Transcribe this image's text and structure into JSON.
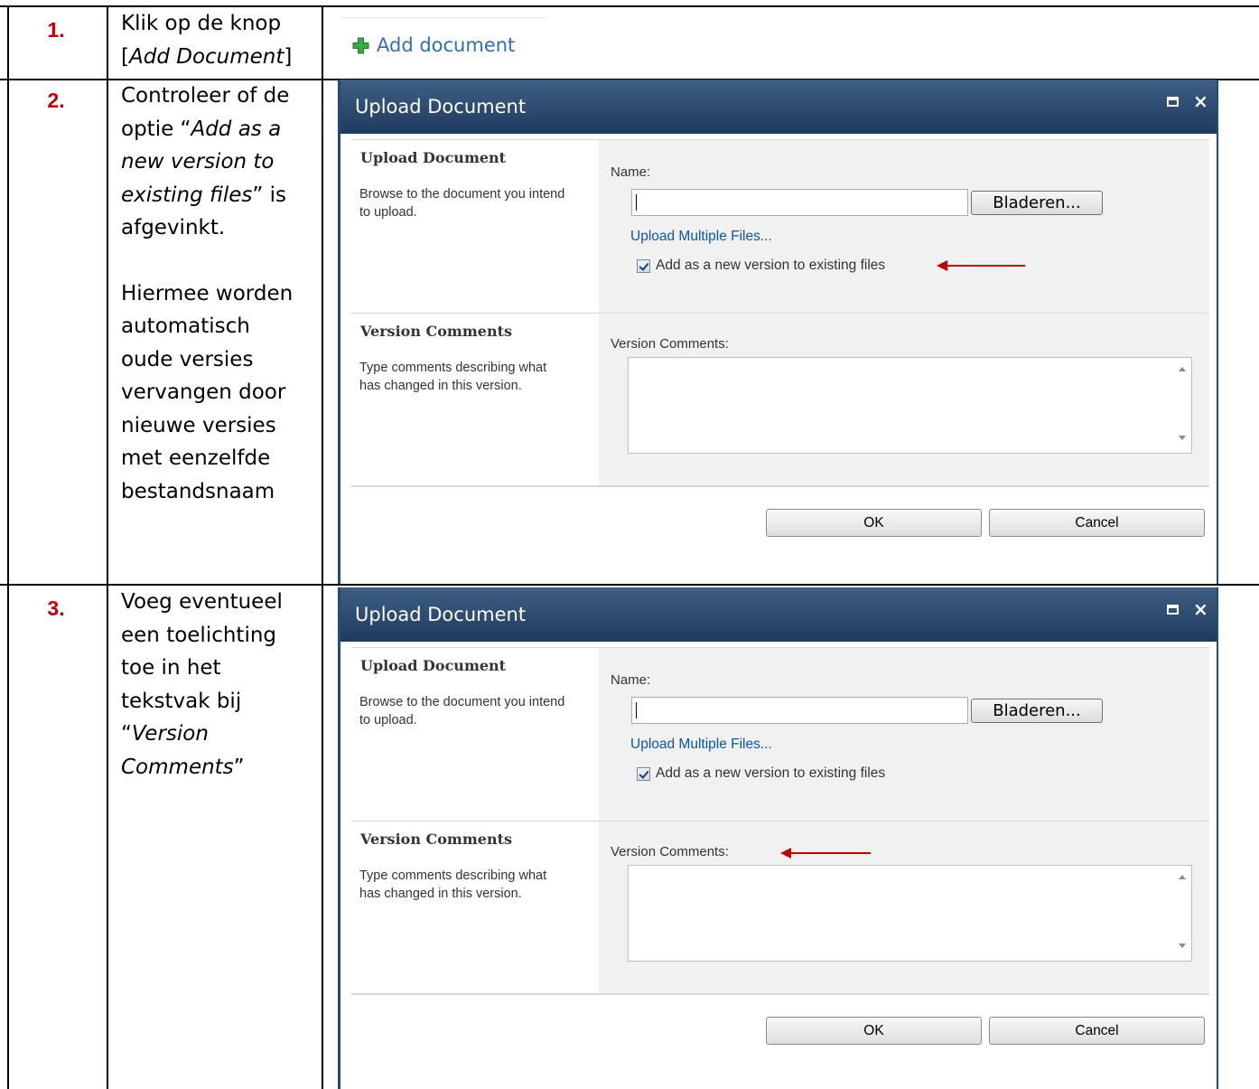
{
  "steps": [
    {
      "number": "1.",
      "line1": "Klik op de knop",
      "line2_pre": "[",
      "line2_em": "Add Document",
      "line2_post": "]"
    },
    {
      "number": "2.",
      "l1": "Controleer of de",
      "l2": "optie “",
      "l2_em": "Add as a",
      "l3_em": "new version to",
      "l4_em": "existing files",
      "l4_post": "” is",
      "l5": "afgevinkt.",
      "p2": [
        "Hiermee worden",
        "automatisch",
        "oude versies",
        "vervangen door",
        "nieuwe versies",
        "met eenzelfde",
        "bestandsnaam"
      ]
    },
    {
      "number": "3.",
      "l1": "Voeg eventueel",
      "l2": "een toelichting",
      "l3": "toe in het",
      "l4": "tekstvak bij",
      "l5_pre": "“",
      "l5_em": "Version",
      "l6_em": "Comments",
      "l6_post": "”"
    }
  ],
  "add_document": {
    "label": "Add document",
    "icon": "plus-icon",
    "icon_color": "#3aa845"
  },
  "dialog": {
    "title": "Upload Document",
    "upload_section": {
      "title": "Upload Document",
      "description": "Browse to the document you intend to upload.",
      "name_label": "Name:",
      "name_value": "",
      "browse_label": "Bladeren...",
      "upload_multiple_label": "Upload Multiple Files...",
      "checkbox_label": "Add as a new version to existing files",
      "checkbox_checked": true
    },
    "version_section": {
      "title": "Version Comments",
      "description": "Type comments describing what has changed in this version.",
      "comments_label": "Version Comments:",
      "comments_value": ""
    },
    "ok_label": "OK",
    "cancel_label": "Cancel"
  },
  "colors": {
    "step_number": "#c00000",
    "title_bar": "#2a4a6e",
    "link": "#0b55b0",
    "arrow": "#c00000"
  }
}
